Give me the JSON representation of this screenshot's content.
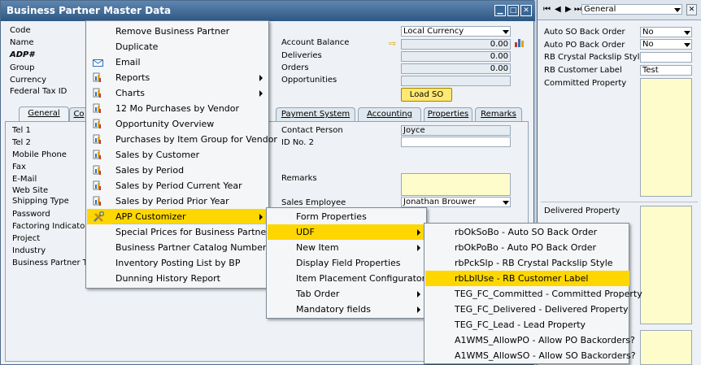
{
  "window": {
    "title": "Business Partner Master Data",
    "header_labels": [
      "Code",
      "Name",
      "ADP#",
      "Group",
      "Currency",
      "Federal Tax ID"
    ],
    "currency_value": "Local Currency",
    "balance_rows": [
      {
        "label": "Account Balance",
        "value": "0.00"
      },
      {
        "label": "Deliveries",
        "value": "0.00"
      },
      {
        "label": "Orders",
        "value": "0.00"
      },
      {
        "label": "Opportunities",
        "value": ""
      }
    ],
    "load_so_label": "Load SO",
    "tabs": [
      "General",
      "Co",
      "Payment System",
      "Accounting",
      "Properties",
      "Remarks"
    ],
    "general_labels": [
      "Tel 1",
      "Tel 2",
      "Mobile Phone",
      "Fax",
      "E-Mail",
      "Web Site",
      "Shipping Type",
      "Password",
      "Factoring Indicator",
      "Project",
      "Industry",
      "Business Partner Typ"
    ],
    "contact_person_label": "Contact Person",
    "contact_person_value": "Joyce",
    "id_no_label": "ID No. 2",
    "remarks_label": "Remarks",
    "sales_employee_label": "Sales Employee",
    "sales_employee_value": "Jonathan Brouwer"
  },
  "right_panel": {
    "nav_select": "General",
    "fields": [
      {
        "label": "Auto SO Back Order",
        "value": "No"
      },
      {
        "label": "Auto PO Back Order",
        "value": "No"
      },
      {
        "label": "RB Crystal Packslip Style",
        "value": ""
      },
      {
        "label": "RB Customer Label",
        "value": "Test"
      }
    ],
    "committed_label": "Committed Property",
    "delivered_label": "Delivered Property"
  },
  "context_menu": {
    "items": [
      {
        "label": "Remove Business Partner",
        "icon": "none"
      },
      {
        "label": "Duplicate",
        "icon": "none"
      },
      {
        "label": "Email",
        "icon": "envelope-icon"
      },
      {
        "label": "Reports",
        "icon": "report-icon",
        "submenu": true
      },
      {
        "label": "Charts",
        "icon": "report-icon",
        "submenu": true
      },
      {
        "label": "12 Mo Purchases by Vendor",
        "icon": "report-icon"
      },
      {
        "label": "Opportunity Overview",
        "icon": "report-icon"
      },
      {
        "label": "Purchases by Item Group for Vendor",
        "icon": "report-icon"
      },
      {
        "label": "Sales by Customer",
        "icon": "report-icon"
      },
      {
        "label": "Sales by Period",
        "icon": "report-icon"
      },
      {
        "label": "Sales by Period Current Year",
        "icon": "report-icon"
      },
      {
        "label": "Sales by Period Prior Year",
        "icon": "report-icon"
      },
      {
        "label": "APP Customizer",
        "icon": "tools-icon",
        "submenu": true,
        "highlighted": true
      },
      {
        "label": "Special Prices for Business Partners",
        "icon": "none"
      },
      {
        "label": "Business Partner Catalog Numbers",
        "icon": "none"
      },
      {
        "label": "Inventory Posting List by BP",
        "icon": "none"
      },
      {
        "label": "Dunning History Report",
        "icon": "none"
      }
    ]
  },
  "customizer_menu": {
    "items": [
      {
        "label": "Form Properties"
      },
      {
        "label": "UDF",
        "submenu": true,
        "highlighted": true
      },
      {
        "label": "New Item",
        "submenu": true
      },
      {
        "label": "Display Field Properties"
      },
      {
        "label": "Item Placement Configurator"
      },
      {
        "label": "Tab Order",
        "submenu": true
      },
      {
        "label": "Mandatory fields",
        "submenu": true
      }
    ]
  },
  "udf_menu": {
    "items": [
      {
        "label": "rbOkSoBo - Auto SO Back Order"
      },
      {
        "label": "rbOkPoBo - Auto PO Back Order"
      },
      {
        "label": "rbPckSlp - RB Crystal Packslip Style"
      },
      {
        "label": "rbLblUse - RB Customer Label",
        "highlighted": true
      },
      {
        "label": "TEG_FC_Committed - Committed Property"
      },
      {
        "label": "TEG_FC_Delivered - Delivered Property"
      },
      {
        "label": "TEG_FC_Lead - Lead Property"
      },
      {
        "label": "A1WMS_AllowPO - Allow PO Backorders?"
      },
      {
        "label": "A1WMS_AllowSO - Allow SO Backorders?"
      }
    ]
  },
  "colors": {
    "highlight": "#ffd700",
    "titlebar": "#2d5783",
    "readonly_field": "#e5ecf2",
    "yellow_field": "#fffccc"
  }
}
